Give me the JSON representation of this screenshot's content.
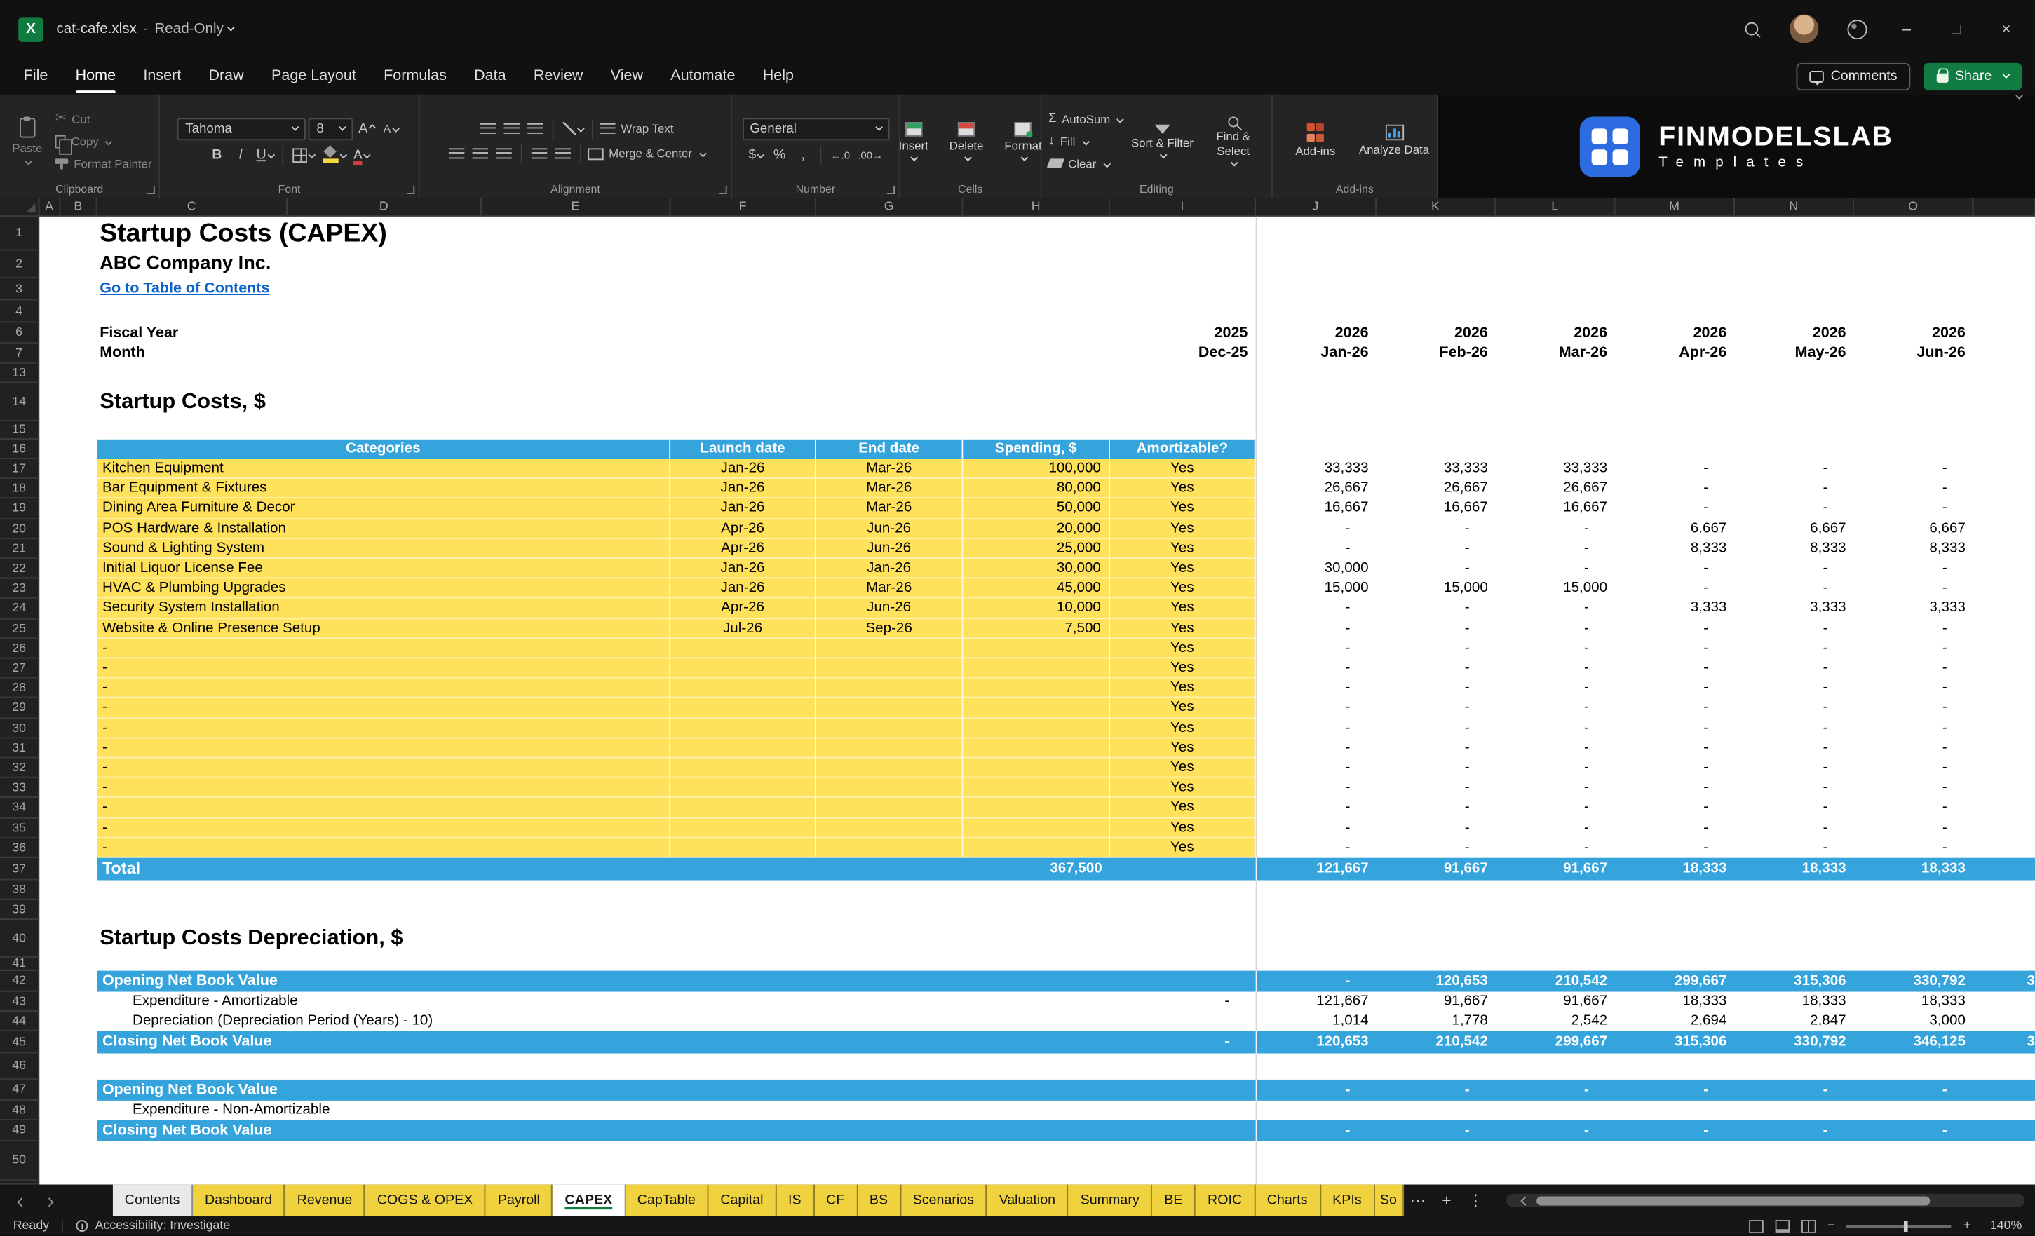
{
  "colors": {
    "band_blue": "#35A3DC",
    "input_yellow": "#FFE15C",
    "link_blue": "#0B61C9",
    "tab_yellow": "#F0D23E",
    "brand_blue": "#2C6BE0",
    "share_green": "#107C41",
    "excel_green": "#107C41"
  },
  "icons": {
    "excel": "X",
    "minimize": "–",
    "maximize": "□",
    "close": "×",
    "cut": "✂",
    "bold": "B",
    "italic": "I",
    "underline": "U",
    "font_a": "A",
    "autosum": "Σ",
    "fill_arrow": "↓",
    "dollar": "$",
    "percent": "%",
    "comma": ",",
    "inc_decimal": "←.0",
    "dec_decimal": ".00→",
    "more": "···",
    "add": "+",
    "kebab": "⋮",
    "minus": "−"
  },
  "titlebar": {
    "filename": "cat-cafe.xlsx",
    "separator": "-",
    "mode": "Read-Only"
  },
  "menubar": {
    "items": [
      "File",
      "Home",
      "Insert",
      "Draw",
      "Page Layout",
      "Formulas",
      "Data",
      "Review",
      "View",
      "Automate",
      "Help"
    ],
    "active_index": 1,
    "comments": "Comments",
    "share": "Share"
  },
  "ribbon": {
    "clipboard": {
      "label": "Clipboard",
      "paste": "Paste",
      "cut": "Cut",
      "copy": "Copy",
      "format_painter": "Format Painter"
    },
    "font": {
      "label": "Font",
      "family": "Tahoma",
      "size": "8"
    },
    "alignment": {
      "label": "Alignment",
      "wrap": "Wrap Text",
      "merge": "Merge & Center"
    },
    "number": {
      "label": "Number",
      "format": "General"
    },
    "cells": {
      "label": "Cells",
      "insert": "Insert",
      "delete": "Delete",
      "format": "Format"
    },
    "editing": {
      "label": "Editing",
      "autosum": "AutoSum",
      "fill": "Fill",
      "clear": "Clear",
      "sort": "Sort & Filter",
      "find": "Find & Select"
    },
    "addins": {
      "label": "Add-ins",
      "addins": "Add-ins",
      "analyze": "Analyze Data"
    },
    "brand": {
      "name": "FINMODELSLAB",
      "sub": "Templates"
    }
  },
  "grid": {
    "columns": [
      "A",
      "B",
      "C",
      "D",
      "E",
      "F",
      "G",
      "H",
      "I",
      "J",
      "K",
      "L",
      "M",
      "N",
      "O"
    ],
    "rows": [
      "1",
      "2",
      "3",
      "4",
      "6",
      "7",
      "13",
      "14",
      "15",
      "16",
      "17",
      "18",
      "19",
      "20",
      "21",
      "22",
      "23",
      "24",
      "25",
      "26",
      "27",
      "28",
      "29",
      "30",
      "31",
      "32",
      "33",
      "34",
      "35",
      "36",
      "37",
      "38",
      "39",
      "40",
      "41",
      "42",
      "43",
      "44",
      "45",
      "46",
      "47",
      "48",
      "49",
      "50"
    ]
  },
  "sheet": {
    "title": "Startup Costs (CAPEX)",
    "company": "ABC Company Inc.",
    "toc_link": "Go to Table of Contents",
    "fiscal_year_label": "Fiscal Year",
    "month_label": "Month",
    "years": [
      "2025",
      "2026",
      "2026",
      "2026",
      "2026",
      "2026",
      "2026"
    ],
    "months": [
      "Dec-25",
      "Jan-26",
      "Feb-26",
      "Mar-26",
      "Apr-26",
      "May-26",
      "Jun-26"
    ],
    "section_costs": "Startup Costs, $",
    "section_depreciation": "Startup Costs Depreciation, $",
    "costs_table": {
      "headers": {
        "categories": "Categories",
        "launch": "Launch date",
        "end": "End date",
        "spending": "Spending, $",
        "amortizable": "Amortizable?"
      },
      "rows": [
        {
          "category": "Kitchen Equipment",
          "launch": "Jan-26",
          "end": "Mar-26",
          "spending": "100,000",
          "amortizable": "Yes",
          "monthly": [
            "33,333",
            "33,333",
            "33,333",
            "-",
            "-",
            "-"
          ]
        },
        {
          "category": "Bar Equipment & Fixtures",
          "launch": "Jan-26",
          "end": "Mar-26",
          "spending": "80,000",
          "amortizable": "Yes",
          "monthly": [
            "26,667",
            "26,667",
            "26,667",
            "-",
            "-",
            "-"
          ]
        },
        {
          "category": "Dining Area Furniture & Decor",
          "launch": "Jan-26",
          "end": "Mar-26",
          "spending": "50,000",
          "amortizable": "Yes",
          "monthly": [
            "16,667",
            "16,667",
            "16,667",
            "-",
            "-",
            "-"
          ]
        },
        {
          "category": "POS Hardware & Installation",
          "launch": "Apr-26",
          "end": "Jun-26",
          "spending": "20,000",
          "amortizable": "Yes",
          "monthly": [
            "-",
            "-",
            "-",
            "6,667",
            "6,667",
            "6,667"
          ]
        },
        {
          "category": "Sound & Lighting System",
          "launch": "Apr-26",
          "end": "Jun-26",
          "spending": "25,000",
          "amortizable": "Yes",
          "monthly": [
            "-",
            "-",
            "-",
            "8,333",
            "8,333",
            "8,333"
          ]
        },
        {
          "category": "Initial Liquor License Fee",
          "launch": "Jan-26",
          "end": "Jan-26",
          "spending": "30,000",
          "amortizable": "Yes",
          "monthly": [
            "30,000",
            "-",
            "-",
            "-",
            "-",
            "-"
          ]
        },
        {
          "category": "HVAC & Plumbing Upgrades",
          "launch": "Jan-26",
          "end": "Mar-26",
          "spending": "45,000",
          "amortizable": "Yes",
          "monthly": [
            "15,000",
            "15,000",
            "15,000",
            "-",
            "-",
            "-"
          ]
        },
        {
          "category": "Security System Installation",
          "launch": "Apr-26",
          "end": "Jun-26",
          "spending": "10,000",
          "amortizable": "Yes",
          "monthly": [
            "-",
            "-",
            "-",
            "3,333",
            "3,333",
            "3,333"
          ]
        },
        {
          "category": "Website & Online Presence Setup",
          "launch": "Jul-26",
          "end": "Sep-26",
          "spending": "7,500",
          "amortizable": "Yes",
          "monthly": [
            "-",
            "-",
            "-",
            "-",
            "-",
            "-"
          ]
        },
        {
          "category": "-",
          "launch": "",
          "end": "",
          "spending": "",
          "amortizable": "Yes",
          "monthly": [
            "-",
            "-",
            "-",
            "-",
            "-",
            "-"
          ]
        },
        {
          "category": "-",
          "launch": "",
          "end": "",
          "spending": "",
          "amortizable": "Yes",
          "monthly": [
            "-",
            "-",
            "-",
            "-",
            "-",
            "-"
          ]
        },
        {
          "category": "-",
          "launch": "",
          "end": "",
          "spending": "",
          "amortizable": "Yes",
          "monthly": [
            "-",
            "-",
            "-",
            "-",
            "-",
            "-"
          ]
        },
        {
          "category": "-",
          "launch": "",
          "end": "",
          "spending": "",
          "amortizable": "Yes",
          "monthly": [
            "-",
            "-",
            "-",
            "-",
            "-",
            "-"
          ]
        },
        {
          "category": "-",
          "launch": "",
          "end": "",
          "spending": "",
          "amortizable": "Yes",
          "monthly": [
            "-",
            "-",
            "-",
            "-",
            "-",
            "-"
          ]
        },
        {
          "category": "-",
          "launch": "",
          "end": "",
          "spending": "",
          "amortizable": "Yes",
          "monthly": [
            "-",
            "-",
            "-",
            "-",
            "-",
            "-"
          ]
        },
        {
          "category": "-",
          "launch": "",
          "end": "",
          "spending": "",
          "amortizable": "Yes",
          "monthly": [
            "-",
            "-",
            "-",
            "-",
            "-",
            "-"
          ]
        },
        {
          "category": "-",
          "launch": "",
          "end": "",
          "spending": "",
          "amortizable": "Yes",
          "monthly": [
            "-",
            "-",
            "-",
            "-",
            "-",
            "-"
          ]
        },
        {
          "category": "-",
          "launch": "",
          "end": "",
          "spending": "",
          "amortizable": "Yes",
          "monthly": [
            "-",
            "-",
            "-",
            "-",
            "-",
            "-"
          ]
        },
        {
          "category": "-",
          "launch": "",
          "end": "",
          "spending": "",
          "amortizable": "Yes",
          "monthly": [
            "-",
            "-",
            "-",
            "-",
            "-",
            "-"
          ]
        },
        {
          "category": "-",
          "launch": "",
          "end": "",
          "spending": "",
          "amortizable": "Yes",
          "monthly": [
            "-",
            "-",
            "-",
            "-",
            "-",
            "-"
          ]
        }
      ],
      "total": {
        "label": "Total",
        "spending": "367,500",
        "monthly": [
          "121,667",
          "91,667",
          "91,667",
          "18,333",
          "18,333",
          "18,333"
        ]
      }
    },
    "depreciation": {
      "opening": {
        "label": "Opening Net Book Value",
        "dec": "",
        "monthly": [
          "-",
          "120,653",
          "210,542",
          "299,667",
          "315,306",
          "330,792"
        ],
        "clip": "3"
      },
      "expenditure": {
        "label": "Expenditure - Amortizable",
        "dec": "-",
        "monthly": [
          "121,667",
          "91,667",
          "91,667",
          "18,333",
          "18,333",
          "18,333"
        ]
      },
      "dep_period": {
        "label": "Depreciation (Depreciation Period (Years) - 10)",
        "dec": "",
        "monthly": [
          "1,014",
          "1,778",
          "2,542",
          "2,694",
          "2,847",
          "3,000"
        ]
      },
      "closing": {
        "label": "Closing Net Book Value",
        "dec": "-",
        "monthly": [
          "120,653",
          "210,542",
          "299,667",
          "315,306",
          "330,792",
          "346,125"
        ],
        "clip": "3"
      },
      "opening2": {
        "label": "Opening Net Book Value",
        "dec": "",
        "monthly": [
          "-",
          "-",
          "-",
          "-",
          "-",
          "-"
        ]
      },
      "expenditure2": {
        "label": "Expenditure - Non-Amortizable",
        "dec": "",
        "monthly": [
          "",
          "",
          "",
          "",
          "",
          ""
        ]
      },
      "closing2": {
        "label": "Closing Net Book Value",
        "dec": "",
        "monthly": [
          "-",
          "-",
          "-",
          "-",
          "-",
          "-"
        ]
      }
    }
  },
  "tabs": {
    "items": [
      {
        "label": "Contents",
        "color": "light"
      },
      {
        "label": "Dashboard",
        "color": "yellow"
      },
      {
        "label": "Revenue",
        "color": "yellow"
      },
      {
        "label": "COGS & OPEX",
        "color": "yellow"
      },
      {
        "label": "Payroll",
        "color": "yellow"
      },
      {
        "label": "CAPEX",
        "color": "active"
      },
      {
        "label": "CapTable",
        "color": "yellow"
      },
      {
        "label": "Capital",
        "color": "yellow"
      },
      {
        "label": "IS",
        "color": "yellow"
      },
      {
        "label": "CF",
        "color": "yellow"
      },
      {
        "label": "BS",
        "color": "yellow"
      },
      {
        "label": "Scenarios",
        "color": "yellow"
      },
      {
        "label": "Valuation",
        "color": "yellow"
      },
      {
        "label": "Summary",
        "color": "yellow"
      },
      {
        "label": "BE",
        "color": "yellow"
      },
      {
        "label": "ROIC",
        "color": "yellow"
      },
      {
        "label": "Charts",
        "color": "yellow"
      },
      {
        "label": "KPIs",
        "color": "yellow"
      },
      {
        "label": "So",
        "color": "yellow",
        "clip": true
      }
    ]
  },
  "statusbar": {
    "ready": "Ready",
    "accessibility": "Accessibility: Investigate",
    "zoom": "140%"
  }
}
